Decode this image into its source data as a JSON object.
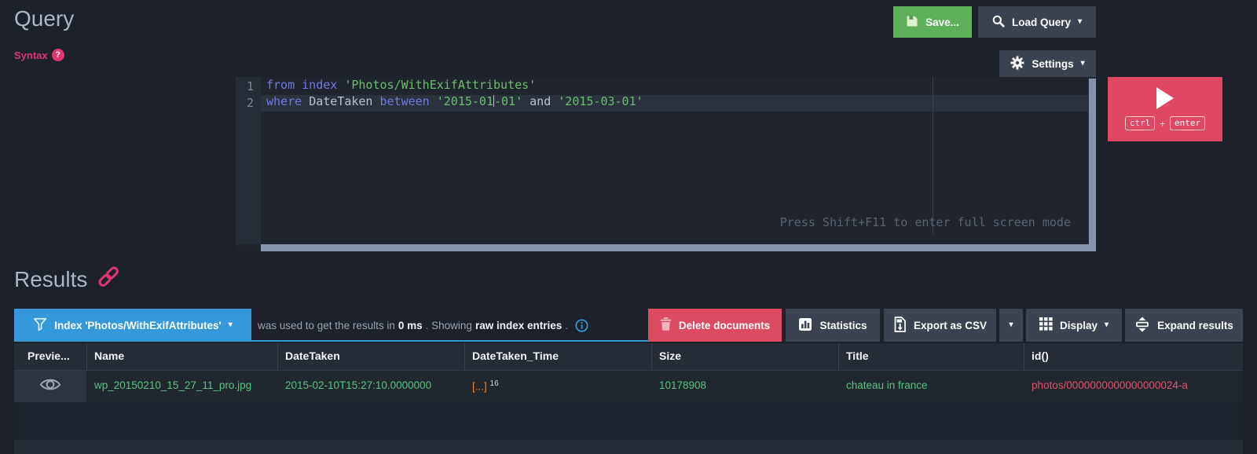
{
  "header": {
    "title": "Query",
    "syntax_label": "Syntax",
    "syntax_badge": "?",
    "save_label": "Save...",
    "load_query_label": "Load Query",
    "settings_label": "Settings"
  },
  "icons": {
    "caret_down": "▾"
  },
  "editor": {
    "line_numbers": [
      "1",
      "2"
    ],
    "line1": {
      "t1": "from ",
      "t2": "index ",
      "t3": "'Photos/WithExifAttributes'"
    },
    "line2": {
      "t1": "where ",
      "t2": "DateTaken ",
      "t3": "between ",
      "t4": "'2015-01",
      "t5": "-01' ",
      "t6": "and ",
      "t7": "'2015-03-01'"
    },
    "fullscreen_hint": "Press Shift+F11 to enter full screen mode",
    "run": {
      "key1": "ctrl",
      "plus": "+",
      "key2": "enter"
    }
  },
  "results": {
    "title": "Results",
    "index_button_label": "Index 'Photos/WithExifAttributes'",
    "meta": {
      "p1": "was used to get the results in ",
      "b1": "0 ms",
      "p2": " . Showing ",
      "b2": "raw index entries",
      "p3": "."
    },
    "toolbar": {
      "delete_label": "Delete documents",
      "statistics_label": "Statistics",
      "export_csv_label": "Export as CSV",
      "display_label": "Display",
      "expand_label": "Expand results"
    },
    "table": {
      "columns": [
        "Previe...",
        "Name",
        "DateTaken",
        "DateTaken_Time",
        "Size",
        "Title",
        "id()"
      ],
      "row": {
        "name": "wp_20150210_15_27_11_pro.jpg",
        "date_taken": "2015-02-10T15:27:10.0000000",
        "date_taken_time": "[...]",
        "date_taken_time_sup": "16",
        "size": "10178908",
        "title": "chateau in france",
        "id": "photos/0000000000000000024-a"
      }
    }
  },
  "colors": {
    "accent_blue": "#3598db",
    "accent_green": "#5cb158",
    "accent_red": "#dd4b63",
    "accent_pink": "#e0356f",
    "value_green": "#57c47f",
    "value_orange": "#e5823d",
    "id_pink": "#e35169",
    "keyword_purple": "#6f79e4",
    "string_green": "#69bd6e"
  }
}
